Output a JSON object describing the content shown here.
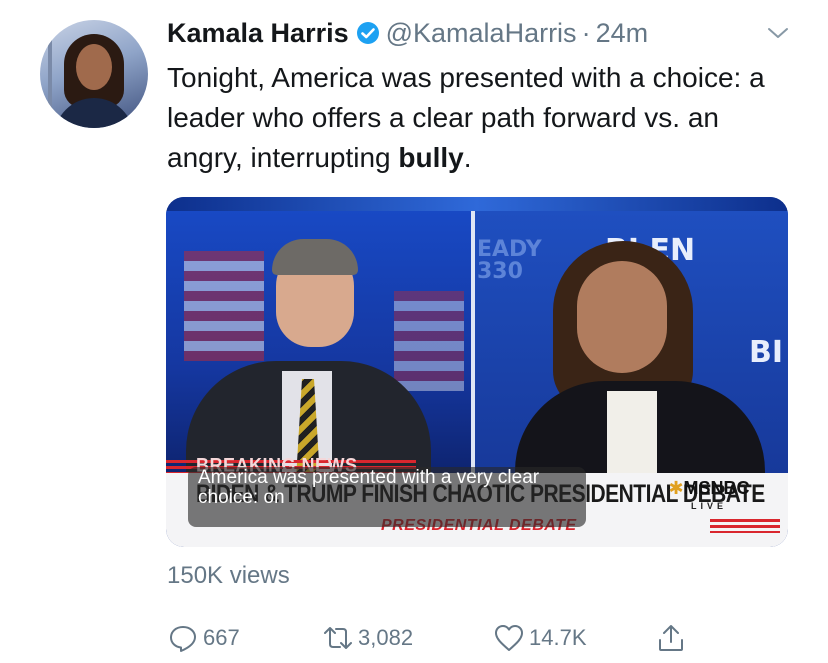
{
  "tweet": {
    "author_name": "Kamala Harris",
    "verified": true,
    "handle": "@KamalaHarris",
    "separator": "·",
    "time": "24m",
    "text_plain": "Tonight, America was presented with a choice: a leader who offers a clear path forward vs. an angry, interrupting ",
    "text_bold": "bully",
    "text_end": "."
  },
  "media": {
    "breaking_label": "BREAKING NEWS",
    "headline": "BIDEN & TRUMP FINISH CHAOTIC PRESIDENTIAL DEBATE",
    "subline": "PRESIDENTIAL DEBATE",
    "network": "MSNBC",
    "network_status": "LIVE",
    "bg_left_text": "EADY\n330",
    "bg_right_top": "BI  EN",
    "bg_right_side": "BI",
    "caption": "America was presented with a very clear choice: on"
  },
  "stats": {
    "views": "150K views"
  },
  "actions": {
    "replies": "667",
    "retweets": "3,082",
    "likes": "14.7K"
  },
  "colors": {
    "verified": "#1da1f2",
    "muted": "#657786",
    "text": "#14171a"
  }
}
